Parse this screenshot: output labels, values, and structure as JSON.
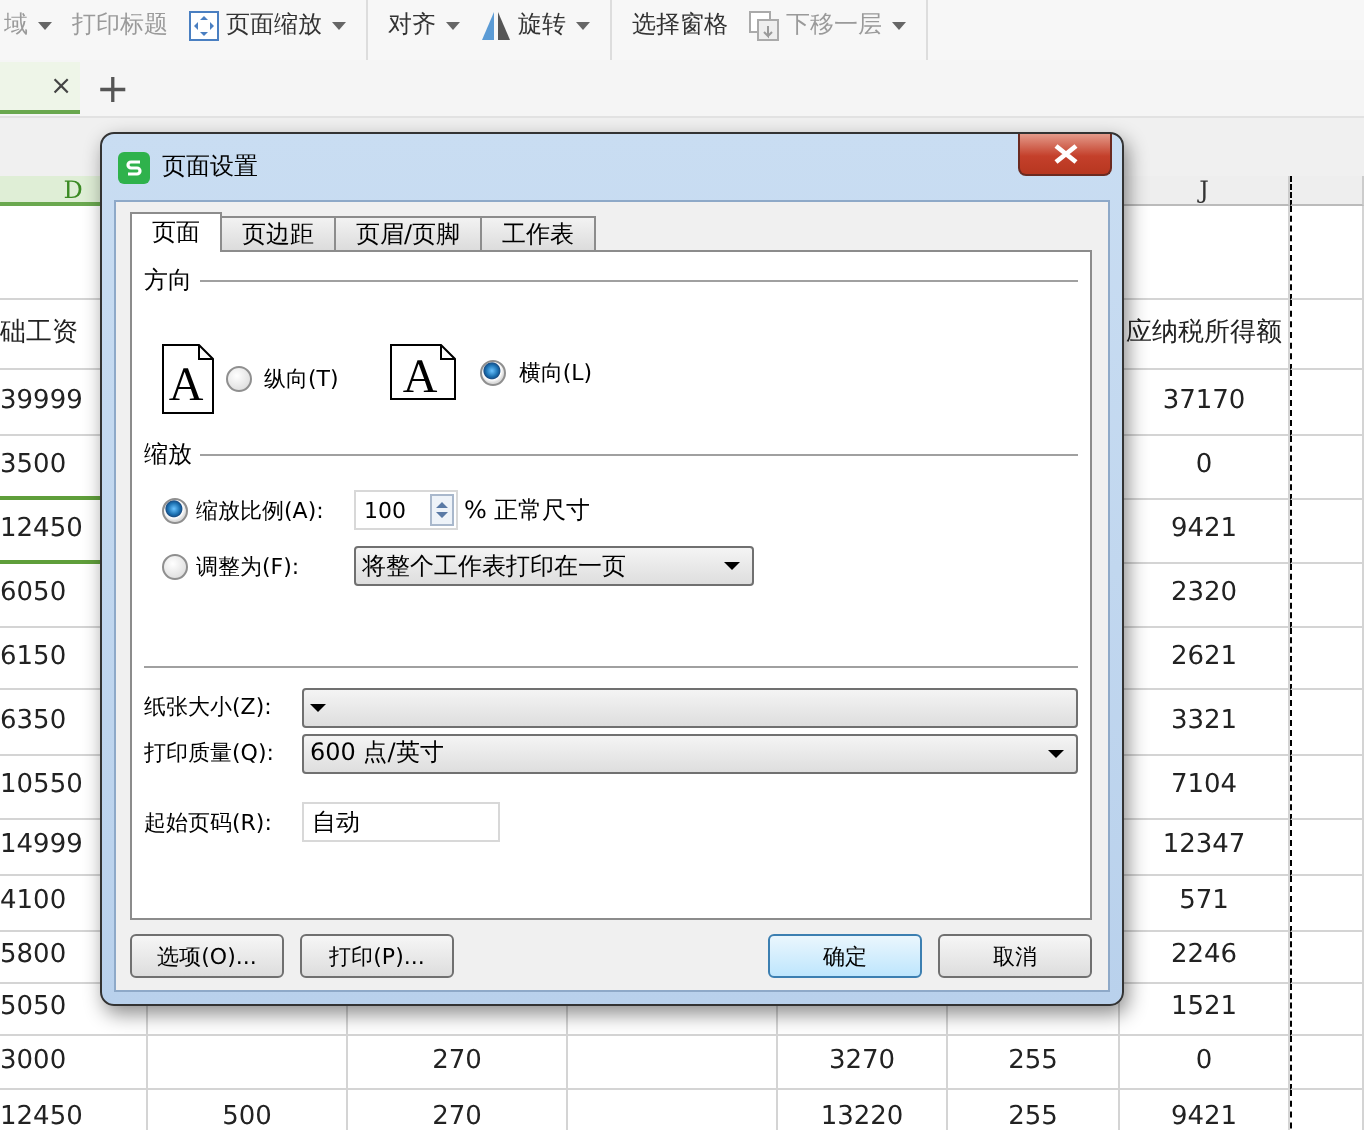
{
  "toolbar": {
    "groups": [
      [
        {
          "label": "域",
          "disabled": true,
          "caret": true
        },
        {
          "label": "打印标题",
          "disabled": true,
          "caret": false
        },
        {
          "label": "页面缩放",
          "disabled": false,
          "caret": true
        }
      ],
      [
        {
          "label": "对齐",
          "disabled": false,
          "caret": true
        },
        {
          "label": "旋转",
          "disabled": false,
          "caret": true
        }
      ],
      [
        {
          "label": "选择窗格",
          "disabled": false,
          "caret": false
        },
        {
          "label": "下移一层",
          "disabled": true,
          "caret": true
        }
      ]
    ]
  },
  "sheet_tabs": {
    "tabs": [
      {
        "close": "×",
        "selected": true
      }
    ],
    "add": "+"
  },
  "sheet": {
    "columns": [
      {
        "header": "D",
        "selected": true
      },
      {},
      {},
      {},
      {},
      {},
      {
        "header": "J",
        "selected": false
      },
      {}
    ],
    "rows": [
      {
        "cells": [
          null,
          null,
          null,
          null,
          null,
          null,
          null,
          null
        ],
        "selected": false
      },
      {
        "cells": [
          "础工资",
          null,
          null,
          null,
          null,
          null,
          "应纳税所得额",
          null
        ],
        "selected": false
      },
      {
        "cells": [
          "39999",
          null,
          null,
          null,
          null,
          null,
          "37170",
          null
        ],
        "selected": false
      },
      {
        "cells": [
          "3500",
          null,
          null,
          null,
          null,
          null,
          "0",
          null
        ],
        "selected": false
      },
      {
        "cells": [
          "12450",
          null,
          null,
          null,
          null,
          null,
          "9421",
          null
        ],
        "selected": true
      },
      {
        "cells": [
          "6050",
          null,
          null,
          null,
          null,
          null,
          "2320",
          null
        ],
        "selected": false
      },
      {
        "cells": [
          "6150",
          null,
          null,
          null,
          null,
          null,
          "2621",
          null
        ],
        "selected": false
      },
      {
        "cells": [
          "6350",
          null,
          null,
          null,
          null,
          null,
          "3321",
          null
        ],
        "selected": false
      },
      {
        "cells": [
          "10550",
          null,
          null,
          null,
          null,
          null,
          "7104",
          null
        ],
        "selected": false
      },
      {
        "cells": [
          "14999",
          null,
          null,
          null,
          null,
          null,
          "12347",
          null
        ],
        "selected": false
      },
      {
        "cells": [
          "4100",
          null,
          null,
          null,
          null,
          null,
          "571",
          null
        ],
        "selected": false
      },
      {
        "cells": [
          "5800",
          null,
          null,
          null,
          null,
          null,
          "2246",
          null
        ],
        "selected": false
      },
      {
        "cells": [
          "5050",
          null,
          null,
          null,
          null,
          null,
          "1521",
          null
        ],
        "selected": false
      },
      {
        "cells": [
          "3000",
          null,
          "270",
          null,
          "3270",
          "255",
          "0",
          null
        ],
        "selected": false
      },
      {
        "cells": [
          "12450",
          "500",
          "270",
          null,
          "13220",
          "255",
          "9421",
          null
        ],
        "selected": false
      }
    ]
  },
  "dialog": {
    "title": "页面设置",
    "tabs": [
      {
        "label": "页面",
        "selected": true
      },
      {
        "label": "页边距",
        "selected": false
      },
      {
        "label": "页眉/页脚",
        "selected": false
      },
      {
        "label": "工作表",
        "selected": false
      }
    ],
    "orientation": {
      "title": "方向",
      "options": [
        {
          "kind": "portrait",
          "glyph": "A",
          "label": "纵向(T)",
          "selected": false
        },
        {
          "kind": "landscape",
          "glyph": "A",
          "label": "横向(L)",
          "selected": true
        }
      ]
    },
    "scaling": {
      "title": "缩放",
      "options": [
        {
          "kind": "percent",
          "label": "缩放比例(A):",
          "selected": true,
          "value": "100",
          "suffix": "% 正常尺寸"
        },
        {
          "kind": "fit",
          "label": "调整为(F):",
          "selected": false,
          "value": "将整个工作表打印在一页"
        }
      ]
    },
    "fields": [
      {
        "kind": "dropdown",
        "label": "纸张大小(Z):"
      },
      {
        "kind": "dropdown",
        "label": "打印质量(Q):",
        "value": "600 点/英寸"
      },
      {
        "kind": "input",
        "label": "起始页码(R):",
        "value": "自动"
      }
    ],
    "buttons": [
      {
        "label": "选项(O)...",
        "default": false
      },
      {
        "label": "打印(P)...",
        "default": false
      },
      {
        "label": "确定",
        "default": true
      },
      {
        "label": "取消",
        "default": false
      }
    ]
  }
}
